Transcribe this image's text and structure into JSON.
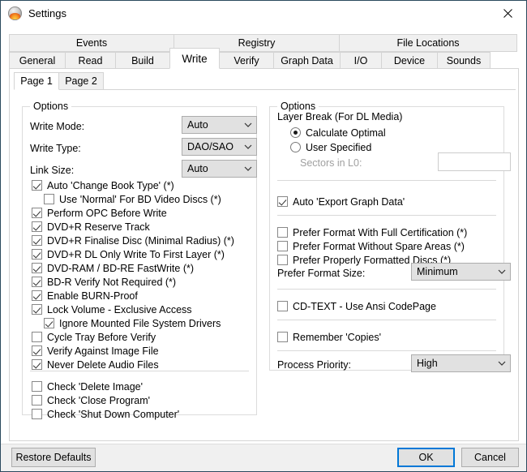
{
  "window": {
    "title": "Settings",
    "icon": "imgburn-disc-flame-icon",
    "close_label": "✕"
  },
  "tabs": {
    "row1": [
      {
        "label": "Events",
        "selected": false
      },
      {
        "label": "Registry",
        "selected": false
      },
      {
        "label": "File Locations",
        "selected": false
      }
    ],
    "row2": [
      {
        "label": "General",
        "selected": false
      },
      {
        "label": "Read",
        "selected": false
      },
      {
        "label": "Build",
        "selected": false
      },
      {
        "label": "Write",
        "selected": true
      },
      {
        "label": "Verify",
        "selected": false
      },
      {
        "label": "Graph Data",
        "selected": false
      },
      {
        "label": "I/O",
        "selected": false
      },
      {
        "label": "Device",
        "selected": false
      },
      {
        "label": "Sounds",
        "selected": false
      }
    ]
  },
  "subtabs": [
    {
      "label": "Page 1",
      "selected": true
    },
    {
      "label": "Page 2",
      "selected": false
    }
  ],
  "left_panel": {
    "title": "Options",
    "fields": [
      {
        "label": "Write Mode:",
        "value": "Auto"
      },
      {
        "label": "Write Type:",
        "value": "DAO/SAO"
      },
      {
        "label": "Link Size:",
        "value": "Auto"
      }
    ],
    "checkboxes": [
      {
        "label": "Auto 'Change Book Type' (*)",
        "checked": true,
        "indent": false
      },
      {
        "label": "Use 'Normal' For BD Video Discs (*)",
        "checked": false,
        "indent": true
      },
      {
        "label": "Perform OPC Before Write",
        "checked": true,
        "indent": false
      },
      {
        "label": "DVD+R Reserve Track",
        "checked": true,
        "indent": false
      },
      {
        "label": "DVD+R Finalise Disc (Minimal Radius) (*)",
        "checked": true,
        "indent": false
      },
      {
        "label": "DVD+R DL Only Write To First Layer (*)",
        "checked": true,
        "indent": false
      },
      {
        "label": "DVD-RAM / BD-RE FastWrite (*)",
        "checked": true,
        "indent": false
      },
      {
        "label": "BD-R Verify Not Required (*)",
        "checked": true,
        "indent": false
      },
      {
        "label": "Enable BURN-Proof",
        "checked": true,
        "indent": false
      },
      {
        "label": "Lock Volume - Exclusive Access",
        "checked": true,
        "indent": false
      },
      {
        "label": "Ignore Mounted File System Drivers",
        "checked": true,
        "indent": true
      },
      {
        "label": "Cycle Tray Before Verify",
        "checked": false,
        "indent": false
      },
      {
        "label": "Verify Against Image File",
        "checked": true,
        "indent": false
      },
      {
        "label": "Never Delete Audio Files",
        "checked": true,
        "indent": false
      }
    ],
    "checkboxes_bottom": [
      {
        "label": "Check 'Delete Image'",
        "checked": false
      },
      {
        "label": "Check 'Close Program'",
        "checked": false
      },
      {
        "label": "Check 'Shut Down Computer'",
        "checked": false
      }
    ]
  },
  "right_panel": {
    "title": "Options",
    "layer_break_label": "Layer Break (For DL Media)",
    "radios": [
      {
        "label": "Calculate Optimal",
        "selected": true
      },
      {
        "label": "User Specified",
        "selected": false
      }
    ],
    "sectors_label": "Sectors in L0:",
    "sectors_value": "",
    "sectors_disabled": true,
    "auto_export": {
      "label": "Auto 'Export Graph Data'",
      "checked": true
    },
    "prefer_checkboxes": [
      {
        "label": "Prefer Format With Full Certification (*)",
        "checked": false
      },
      {
        "label": "Prefer Format Without Spare Areas (*)",
        "checked": false
      },
      {
        "label": "Prefer Properly Formatted Discs (*)",
        "checked": false
      }
    ],
    "prefer_format_size": {
      "label": "Prefer Format Size:",
      "value": "Minimum"
    },
    "cd_text": {
      "label": "CD-TEXT - Use Ansi CodePage",
      "checked": false
    },
    "remember_copies": {
      "label": "Remember 'Copies'",
      "checked": false
    },
    "process_priority": {
      "label": "Process Priority:",
      "value": "High"
    }
  },
  "footer": {
    "restore_defaults": "Restore Defaults",
    "ok": "OK",
    "cancel": "Cancel"
  },
  "colors": {
    "accent": "#0078d7",
    "window_border": "#2b4a5e",
    "control_face": "#e1e1e1",
    "tab_face": "#f0f0f0",
    "footer_face": "#f0f0f0"
  }
}
